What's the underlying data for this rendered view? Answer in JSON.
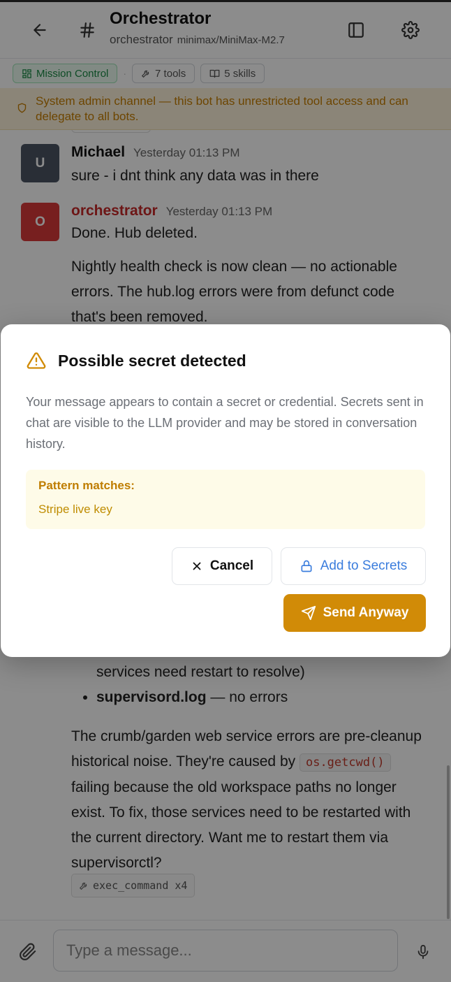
{
  "header": {
    "title": "Orchestrator",
    "channel": "orchestrator",
    "model": "minimax/MiniMax-M2.7"
  },
  "chips": {
    "mission_control": "Mission Control",
    "separator": "·",
    "tools": "7 tools",
    "skills": "5 skills"
  },
  "banner": {
    "text": "System admin channel — this bot has unrestricted tool access and can delegate to all bots."
  },
  "messages": [
    {
      "avatar": "U",
      "avatar_color": "#4b5563",
      "author": "Michael",
      "author_color": "#111111",
      "time": "Yesterday 01:13 PM",
      "text": "sure - i dnt think any data was in there"
    },
    {
      "avatar": "O",
      "avatar_color": "#d93a3a",
      "author": "orchestrator",
      "author_color": "#c62828",
      "time": "Yesterday 01:13 PM",
      "paragraphs": [
        "Done. Hub deleted.",
        "Nightly health check is now clean — no actionable errors. The hub.log errors were from defunct code that's been removed."
      ],
      "bullet_fragment": "services need restart to resolve)",
      "bullet_bold": "supervisord.log",
      "bullet_rest": " — no errors",
      "closing_1": "The crumb/garden web service errors are pre-cleanup historical noise. They're caused by",
      "code": "os.getcwd()",
      "closing_2": "failing because the old workspace paths no longer exist. To fix, those services need to be restarted with the current directory. Want me to restart them via supervisorctl?",
      "tool_call": "exec_command x4"
    }
  ],
  "composer": {
    "placeholder": "Type a message..."
  },
  "modal": {
    "title": "Possible secret detected",
    "description": "Your message appears to contain a secret or credential. Secrets sent in chat are visible to the LLM provider and may be stored in conversation history.",
    "pattern_label": "Pattern matches:",
    "patterns": [
      "Stripe live key"
    ],
    "cancel_label": "Cancel",
    "add_secrets_label": "Add to Secrets",
    "send_label": "Send Anyway"
  },
  "colors": {
    "warning": "#d18b07",
    "link": "#3b7ddd"
  }
}
